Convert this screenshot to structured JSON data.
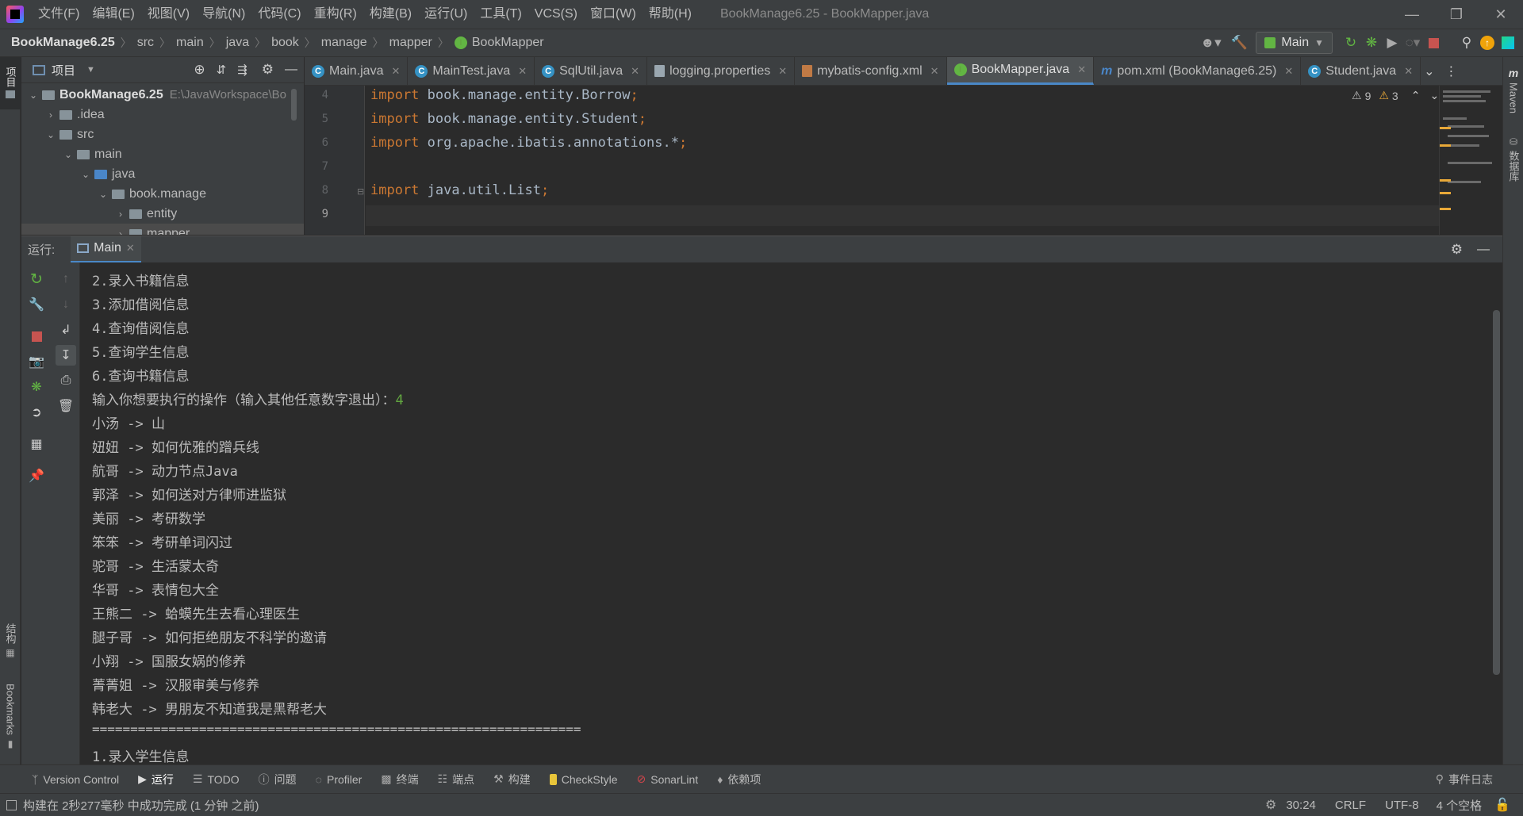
{
  "menubar": {
    "items": [
      "文件(F)",
      "编辑(E)",
      "视图(V)",
      "导航(N)",
      "代码(C)",
      "重构(R)",
      "构建(B)",
      "运行(U)",
      "工具(T)",
      "VCS(S)",
      "窗口(W)",
      "帮助(H)"
    ],
    "window_title": "BookManage6.25 - BookMapper.java"
  },
  "breadcrumb": [
    "BookManage6.25",
    "src",
    "main",
    "java",
    "book",
    "manage",
    "mapper",
    "BookMapper"
  ],
  "toolbar": {
    "run_config": "Main"
  },
  "left_strip": {
    "project": "项目",
    "structure": "结构",
    "bookmarks": "Bookmarks"
  },
  "right_strip": {
    "maven": "Maven",
    "database": "数据库"
  },
  "project_panel": {
    "title": "项目",
    "tree": [
      {
        "label": "BookManage6.25",
        "extra": "E:\\JavaWorkspace\\Bo"
      },
      {
        "label": ".idea"
      },
      {
        "label": "src"
      },
      {
        "label": "main"
      },
      {
        "label": "java"
      },
      {
        "label": "book.manage"
      },
      {
        "label": "entity"
      },
      {
        "label": "mapper"
      }
    ]
  },
  "tabs": [
    "Main.java",
    "MainTest.java",
    "SqlUtil.java",
    "logging.properties",
    "mybatis-config.xml",
    "BookMapper.java",
    "pom.xml (BookManage6.25)",
    "Student.java"
  ],
  "editor": {
    "warnings": "9",
    "weak_warnings": "3",
    "lines": [
      {
        "n": "4",
        "kw": "import",
        "rest": " book.manage.entity.Borrow",
        "semi": ";"
      },
      {
        "n": "5",
        "kw": "import",
        "rest": " book.manage.entity.Student",
        "semi": ";"
      },
      {
        "n": "6",
        "kw": "import",
        "rest": " org.apache.ibatis.annotations.*",
        "semi": ";"
      },
      {
        "n": "7",
        "kw": "",
        "rest": "",
        "semi": ""
      },
      {
        "n": "8",
        "kw": "import",
        "rest": " java.util.List",
        "semi": ";"
      },
      {
        "n": "9",
        "kw": "",
        "rest": "",
        "semi": ""
      }
    ]
  },
  "run_panel": {
    "label": "运行:",
    "tab": "Main"
  },
  "console": {
    "lines": [
      "2.录入书籍信息",
      "3.添加借阅信息",
      "4.查询借阅信息",
      "5.查询学生信息",
      "6.查询书籍信息",
      "输入你想要执行的操作（输入其他任意数字退出）：",
      "小汤 -> 山",
      "妞妞 -> 如何优雅的蹭兵线",
      "航哥 -> 动力节点Java",
      "郭泽 -> 如何送对方律师进监狱",
      "美丽 -> 考研数学",
      "笨笨 -> 考研单词闪过",
      "驼哥 -> 生活蒙太奇",
      "华哥 -> 表情包大全",
      "王熊二 -> 蛤蟆先生去看心理医生",
      "腿子哥 -> 如何拒绝朋友不科学的邀请",
      "小翔 -> 国服女娲的修养",
      "菁菁姐 -> 汉服审美与修养",
      "韩老大 -> 男朋友不知道我是黑帮老大",
      "================================================================",
      "1.录入学生信息"
    ],
    "user_input": "4"
  },
  "bottom_toolbar": [
    "Version Control",
    "运行",
    "TODO",
    "问题",
    "Profiler",
    "终端",
    "端点",
    "构建",
    "CheckStyle",
    "SonarLint",
    "依赖项"
  ],
  "event_log": "事件日志",
  "status": {
    "message": "构建在 2秒277毫秒 中成功完成 (1 分钟 之前)",
    "position": "30:24",
    "line_sep": "CRLF",
    "encoding": "UTF-8",
    "indent": "4 个空格"
  }
}
